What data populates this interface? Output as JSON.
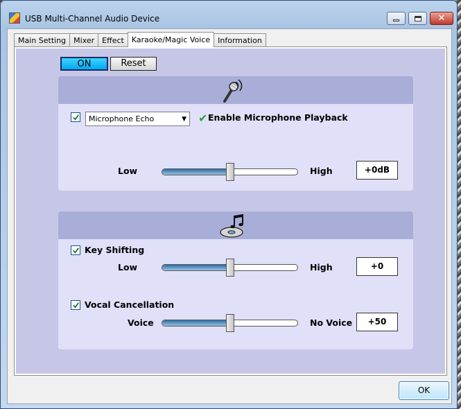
{
  "window": {
    "title": "USB Multi-Channel Audio Device",
    "icons": {
      "app": "app-icon",
      "minimize": "minimize-icon",
      "maximize": "maximize-icon",
      "close": "close-icon"
    },
    "close_glyph": "✕"
  },
  "tabs": [
    {
      "label": "Main Setting",
      "active": false
    },
    {
      "label": "Mixer",
      "active": false
    },
    {
      "label": "Effect",
      "active": false
    },
    {
      "label": "Karaoke/Magic Voice",
      "active": true
    },
    {
      "label": "Information",
      "active": false
    }
  ],
  "controls": {
    "on_label": "ON",
    "reset_label": "Reset"
  },
  "microphone": {
    "icon": "microphone-icon",
    "enabled_checked": true,
    "effect_select": {
      "value": "Microphone Echo",
      "arrow": "▼"
    },
    "playback_check_glyph": "✔",
    "playback_label": "Enable Microphone Playback",
    "slider": {
      "low_label": "Low",
      "high_label": "High",
      "level": 0.5,
      "value_text": "+0dB"
    }
  },
  "karaoke": {
    "icon": "music-note-disc-icon",
    "key_shifting": {
      "checked": true,
      "label": "Key Shifting",
      "slider": {
        "low_label": "Low",
        "high_label": "High",
        "level": 0.5,
        "value_text": "+0"
      }
    },
    "vocal_cancellation": {
      "checked": true,
      "label": "Vocal Cancellation",
      "slider": {
        "low_label": "Voice",
        "high_label": "No Voice",
        "level": 0.5,
        "value_text": "+50"
      }
    }
  },
  "footer": {
    "ok_label": "OK"
  },
  "colors": {
    "accent_on": "#00a9f0",
    "panel_bg": "#c6c7e7",
    "section_bg": "#e0e0f8",
    "band_bg": "#a9aed8",
    "check_green": "#2f9e3f"
  }
}
